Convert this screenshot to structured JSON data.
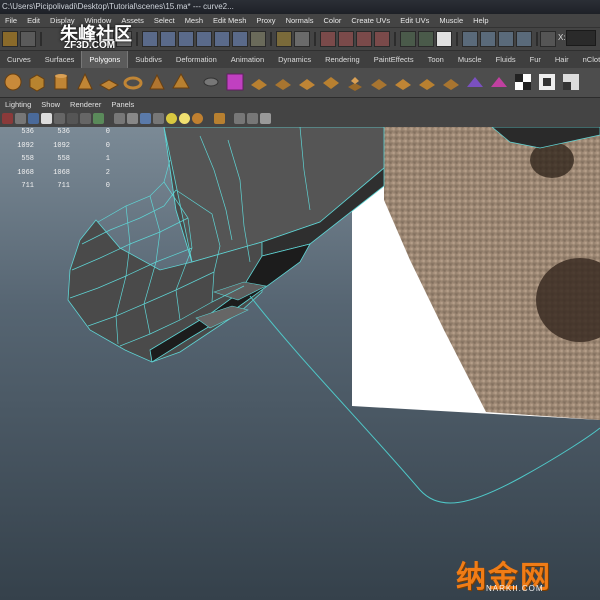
{
  "window": {
    "title": "C:\\Users\\Picipolivadi\\Desktop\\Tutorial\\scenes\\15.ma*   ---   curve2..."
  },
  "menu": [
    "File",
    "Edit",
    "Display",
    "Window",
    "Assets",
    "Select",
    "Mesh",
    "Edit Mesh",
    "Proxy",
    "Normals",
    "Color",
    "Create UVs",
    "Edit UVs",
    "Muscle",
    "Help"
  ],
  "shelf_tabs": [
    "Curves",
    "Surfaces",
    "Polygons",
    "Subdivs",
    "Deformation",
    "Animation",
    "Dynamics",
    "Rendering",
    "PaintEffects",
    "Toon",
    "Muscle",
    "Fluids",
    "Fur",
    "Hair",
    "nCloth"
  ],
  "shelf_active": "Polygons",
  "panel_menu": [
    "Lighting",
    "Show",
    "Renderer",
    "Panels"
  ],
  "status_field_label": "X:",
  "hud_rows": [
    [
      "536",
      "536",
      "0"
    ],
    [
      "1092",
      "1092",
      "0"
    ],
    [
      "558",
      "558",
      "1"
    ],
    [
      "1068",
      "1068",
      "2"
    ],
    [
      "711",
      "711",
      "0"
    ]
  ],
  "watermarks": {
    "top": "朱峰社区",
    "top_sub": "ZF3D.COM",
    "bottom": "纳金网",
    "bottom_sub": "NARKII.COM"
  },
  "colors": {
    "wire": "#5fd4d4",
    "ui_bg": "#444444",
    "shelf_active": "#5b5b5b"
  }
}
